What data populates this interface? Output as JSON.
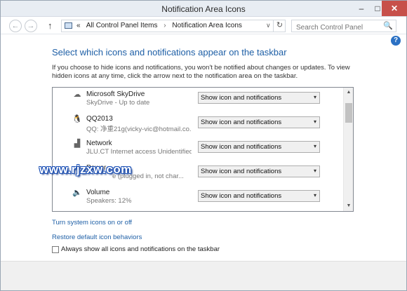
{
  "window": {
    "title": "Notification Area Icons",
    "min_glyph": "–",
    "max_glyph": "□",
    "close_glyph": "✕"
  },
  "nav": {
    "back_glyph": "←",
    "forward_glyph": "→",
    "up_glyph": "↑",
    "overflow_glyph": "«",
    "crumbs": [
      "All Control Panel Items",
      "Notification Area Icons"
    ],
    "crumb_sep": "›",
    "dropdown_glyph": "∨",
    "refresh_glyph": "↻",
    "search_placeholder": "Search Control Panel",
    "search_glyph": "🔍"
  },
  "help_glyph": "?",
  "main": {
    "heading": "Select which icons and notifications appear on the taskbar",
    "description": "If you choose to hide icons and notifications, you won't be notified about changes or updates. To view hidden icons at any time, click the arrow next to the notification area on the taskbar.",
    "items": [
      {
        "name": "Microsoft SkyDrive",
        "sub": "SkyDrive - Up to date",
        "icon": "skydrive-icon",
        "glyph": "☁",
        "behavior": "Show icon and notifications"
      },
      {
        "name": "QQ2013",
        "sub": "QQ: 净重21g(vicky-vic@hotmail.co...",
        "icon": "qq-icon",
        "glyph": "🐧",
        "behavior": "Show icon and notifications"
      },
      {
        "name": "Network",
        "sub": "JLU.CT Internet access  Unidentified ...",
        "icon": "network-icon",
        "glyph": "▟",
        "behavior": "Show icon and notifications"
      },
      {
        "name": "Power",
        "sub": "e (plugged in, not char...",
        "icon": "power-icon",
        "glyph": "▭",
        "behavior": "Show icon and notifications"
      },
      {
        "name": "Volume",
        "sub": "Speakers: 12%",
        "icon": "volume-icon",
        "glyph": "🔈",
        "behavior": "Show icon and notifications"
      }
    ],
    "select_arrow": "▾",
    "scroll_up": "▲",
    "scroll_down": "▼",
    "turn_system_icons": "Turn system icons on or off",
    "restore_defaults": "Restore default icon behaviors",
    "always_show_label": "Always show all icons and notifications on the taskbar",
    "always_show_checked": false
  },
  "watermark": "www.rjzxw.com",
  "colors": {
    "accent": "#1e5fa6",
    "close": "#c7504a",
    "help": "#2b71c4"
  }
}
